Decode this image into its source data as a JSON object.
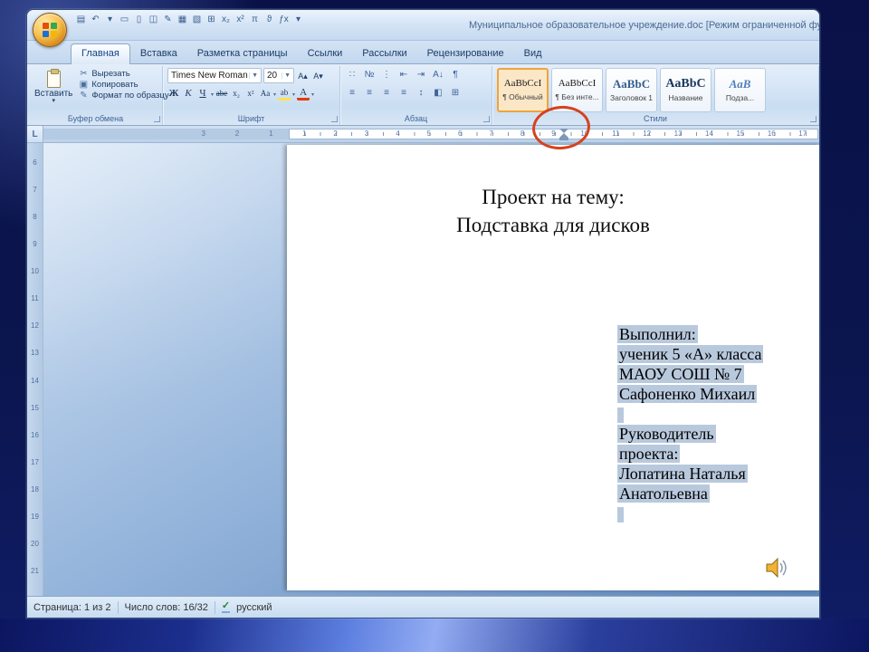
{
  "window": {
    "title": "Муниципальное образовательное учреждение.doc [Режим ограниченной функцио"
  },
  "qat": {
    "icons": [
      {
        "name": "save-icon",
        "glyph": "▤"
      },
      {
        "name": "undo-icon",
        "glyph": "↶"
      },
      {
        "name": "undo-dropdown-icon",
        "glyph": "▾"
      },
      {
        "name": "open-icon",
        "glyph": "▭"
      },
      {
        "name": "new-document-icon",
        "glyph": "▯"
      },
      {
        "name": "print-preview-icon",
        "glyph": "◫"
      },
      {
        "name": "edit-icon",
        "glyph": "✎"
      },
      {
        "name": "table-icon",
        "glyph": "▦"
      },
      {
        "name": "chart-icon",
        "glyph": "▧"
      },
      {
        "name": "borders-icon",
        "glyph": "⊞"
      },
      {
        "name": "subscript-icon",
        "glyph": "x₂"
      },
      {
        "name": "superscript-icon",
        "glyph": "x²"
      },
      {
        "name": "pi-icon",
        "glyph": "π"
      },
      {
        "name": "theta-icon",
        "glyph": "ϑ"
      },
      {
        "name": "function-icon",
        "glyph": "ƒx"
      },
      {
        "name": "qat-menu-icon",
        "glyph": "▾"
      }
    ]
  },
  "ribbon": {
    "tabs": [
      "Главная",
      "Вставка",
      "Разметка страницы",
      "Ссылки",
      "Рассылки",
      "Рецензирование",
      "Вид"
    ],
    "clipboard": {
      "group_label": "Буфер обмена",
      "paste_label": "Вставить",
      "commands": [
        {
          "name": "cut-button",
          "glyph": "✂",
          "label": "Вырезать"
        },
        {
          "name": "copy-button",
          "glyph": "▣",
          "label": "Копировать"
        },
        {
          "name": "format-painter-button",
          "glyph": "✎",
          "label": "Формат по образцу"
        }
      ]
    },
    "font": {
      "group_label": "Шрифт",
      "family": "Times New Roman",
      "size": "20",
      "grow": "А▴",
      "shrink": "А▾",
      "bold": "Ж",
      "italic": "К",
      "underline": "Ч",
      "strike": "abe",
      "subscript": "x₂",
      "superscript": "x²",
      "case_btn": "Aa",
      "highlight": "ab",
      "font_color": "А"
    },
    "paragraph": {
      "group_label": "Абзац",
      "row1": [
        {
          "name": "bullets-icon",
          "glyph": "∷"
        },
        {
          "name": "numbering-icon",
          "glyph": "№"
        },
        {
          "name": "multilevel-list-icon",
          "glyph": "⋮"
        },
        {
          "name": "decrease-indent-icon",
          "glyph": "⇤"
        },
        {
          "name": "increase-indent-icon",
          "glyph": "⇥"
        },
        {
          "name": "sort-icon",
          "glyph": "А↓"
        },
        {
          "name": "pilcrow-icon",
          "glyph": "¶"
        }
      ],
      "row2": [
        {
          "name": "align-left-icon",
          "glyph": "≡"
        },
        {
          "name": "align-center-icon",
          "glyph": "≡"
        },
        {
          "name": "align-right-icon",
          "glyph": "≡"
        },
        {
          "name": "justify-icon",
          "glyph": "≡"
        },
        {
          "name": "line-spacing-icon",
          "glyph": "↕"
        },
        {
          "name": "shading-icon",
          "glyph": "◧"
        },
        {
          "name": "borders-grid-icon",
          "glyph": "⊞"
        }
      ]
    },
    "styles": {
      "group_label": "Стили",
      "items": [
        {
          "preview": "AaBbCcI",
          "name": "¶ Обычный"
        },
        {
          "preview": "AaBbCcI",
          "name": "¶ Без инте..."
        },
        {
          "preview": "AaBbC",
          "name": "Заголовок 1"
        },
        {
          "preview": "AaBbC",
          "name": "Название"
        },
        {
          "preview": "AaB",
          "name": "Подза..."
        }
      ]
    }
  },
  "ruler": {
    "tab_selector": "L",
    "h_margin": [
      "3",
      "2",
      "1"
    ],
    "h_page": [
      "1",
      "2",
      "3",
      "4",
      "5",
      "6",
      "7",
      "8",
      "9",
      "10",
      "11",
      "12",
      "13",
      "14",
      "15",
      "16",
      "17"
    ],
    "v": [
      "6",
      "7",
      "8",
      "9",
      "10",
      "11",
      "12",
      "13",
      "14",
      "15",
      "16",
      "17",
      "18",
      "19",
      "20",
      "21"
    ]
  },
  "document": {
    "title_lines": [
      "Проект на тему:",
      "Подставка для дисков"
    ],
    "selected_lines": [
      "Выполнил:",
      "ученик 5 «А» класса",
      "МАОУ СОШ № 7",
      "Сафоненко Михаил",
      "",
      "Руководитель",
      "проекта:",
      "Лопатина Наталья",
      "Анатольевна",
      ""
    ]
  },
  "status": {
    "page": "Страница: 1 из 2",
    "words": "Число слов: 16/32",
    "spell_glyph": "✓",
    "language": "русский"
  },
  "colors": {
    "selection_highlight": "#b9c9dd",
    "annotation_red": "#d5421e",
    "chrome_blue": "#c5d9ef",
    "style_selected_orange": "#f0a43c"
  }
}
